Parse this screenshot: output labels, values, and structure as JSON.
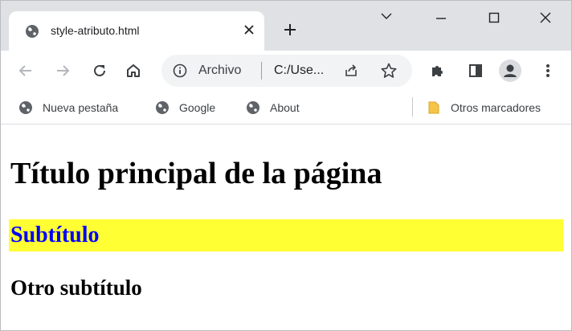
{
  "browser": {
    "tab": {
      "title": "style-atributo.html",
      "favicon": "globe-icon",
      "close_icon": "close-icon"
    },
    "new_tab_icon": "plus-icon",
    "window_controls": [
      "chevron-down-icon",
      "minimize-icon",
      "maximize-icon",
      "close-icon"
    ],
    "toolbar": {
      "buttons": [
        "back-icon",
        "forward-icon",
        "reload-icon",
        "home-icon"
      ],
      "omnibox": {
        "security_label": "Archivo",
        "url": "C:/Use..."
      },
      "extensions": [
        "puzzle-icon",
        "sidepanel-icon",
        "profile-icon",
        "more-vert-icon"
      ]
    },
    "bookmarks": {
      "items": [
        {
          "label": "Nueva pestaña",
          "icon": "globe-icon"
        },
        {
          "label": "Google",
          "icon": "globe-icon"
        },
        {
          "label": "About",
          "icon": "globe-icon"
        }
      ],
      "other": {
        "label": "Otros marcadores",
        "icon": "folder-icon"
      }
    }
  },
  "page": {
    "h1": "Título principal de la página",
    "h2": "Subtítulo",
    "h3": "Otro subtítulo",
    "colors": {
      "subtitle_background": "#ffff33",
      "subtitle_text": "#0000ff"
    }
  }
}
